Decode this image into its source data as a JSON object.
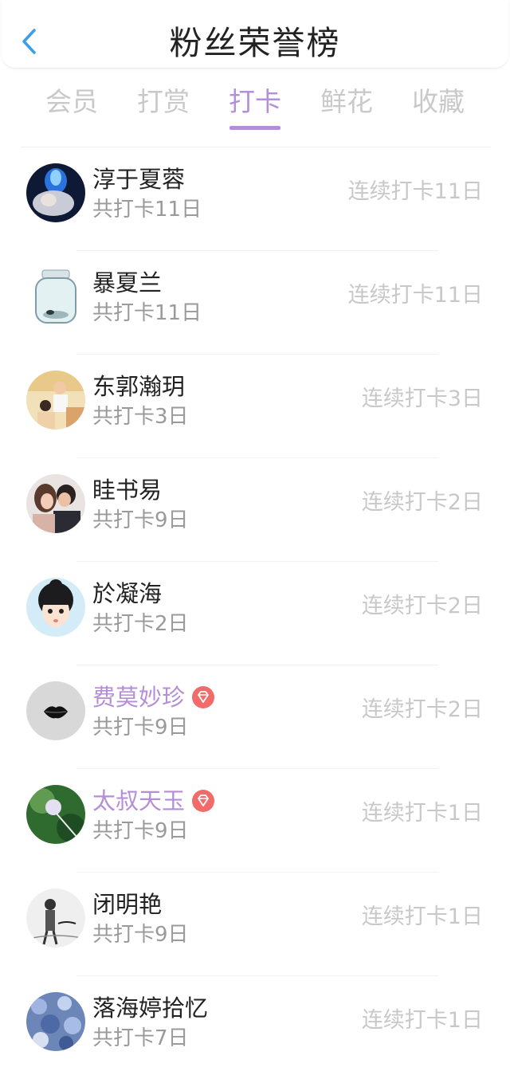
{
  "header": {
    "title": "粉丝荣誉榜"
  },
  "tabs": [
    {
      "label": "会员"
    },
    {
      "label": "打赏"
    },
    {
      "label": "打卡",
      "active": true
    },
    {
      "label": "鲜花"
    },
    {
      "label": "收藏"
    }
  ],
  "colors": {
    "accent": "#b58ed8",
    "back_arrow": "#3a9ee8",
    "vip_badge": "#f26b6b",
    "muted_text": "#9a9a9a",
    "streak_text": "#c8c8c8"
  },
  "fans": [
    {
      "name": "淳于夏蓉",
      "total": "共打卡11日",
      "streak": "连续打卡11日",
      "vip": false,
      "avatar": "avatar-blue-fire"
    },
    {
      "name": "暴夏兰",
      "total": "共打卡11日",
      "streak": "连续打卡11日",
      "vip": false,
      "avatar": "avatar-glass-jar"
    },
    {
      "name": "东郭瀚玥",
      "total": "共打卡3日",
      "streak": "连续打卡3日",
      "vip": false,
      "avatar": "avatar-couple-photo"
    },
    {
      "name": "眭书易",
      "total": "共打卡9日",
      "streak": "连续打卡2日",
      "vip": false,
      "avatar": "avatar-kiss-couple"
    },
    {
      "name": "於凝海",
      "total": "共打卡2日",
      "streak": "连续打卡2日",
      "vip": false,
      "avatar": "avatar-cartoon-girl"
    },
    {
      "name": "费莫妙珍",
      "total": "共打卡9日",
      "streak": "连续打卡2日",
      "vip": true,
      "avatar": "avatar-lips"
    },
    {
      "name": "太叔天玉",
      "total": "共打卡9日",
      "streak": "连续打卡1日",
      "vip": true,
      "avatar": "avatar-green-bokeh"
    },
    {
      "name": "闭明艳",
      "total": "共打卡9日",
      "streak": "连续打卡1日",
      "vip": false,
      "avatar": "avatar-sketch"
    },
    {
      "name": "落海婷拾忆",
      "total": "共打卡7日",
      "streak": "连续打卡1日",
      "vip": false,
      "avatar": "avatar-blue-flowers"
    }
  ]
}
